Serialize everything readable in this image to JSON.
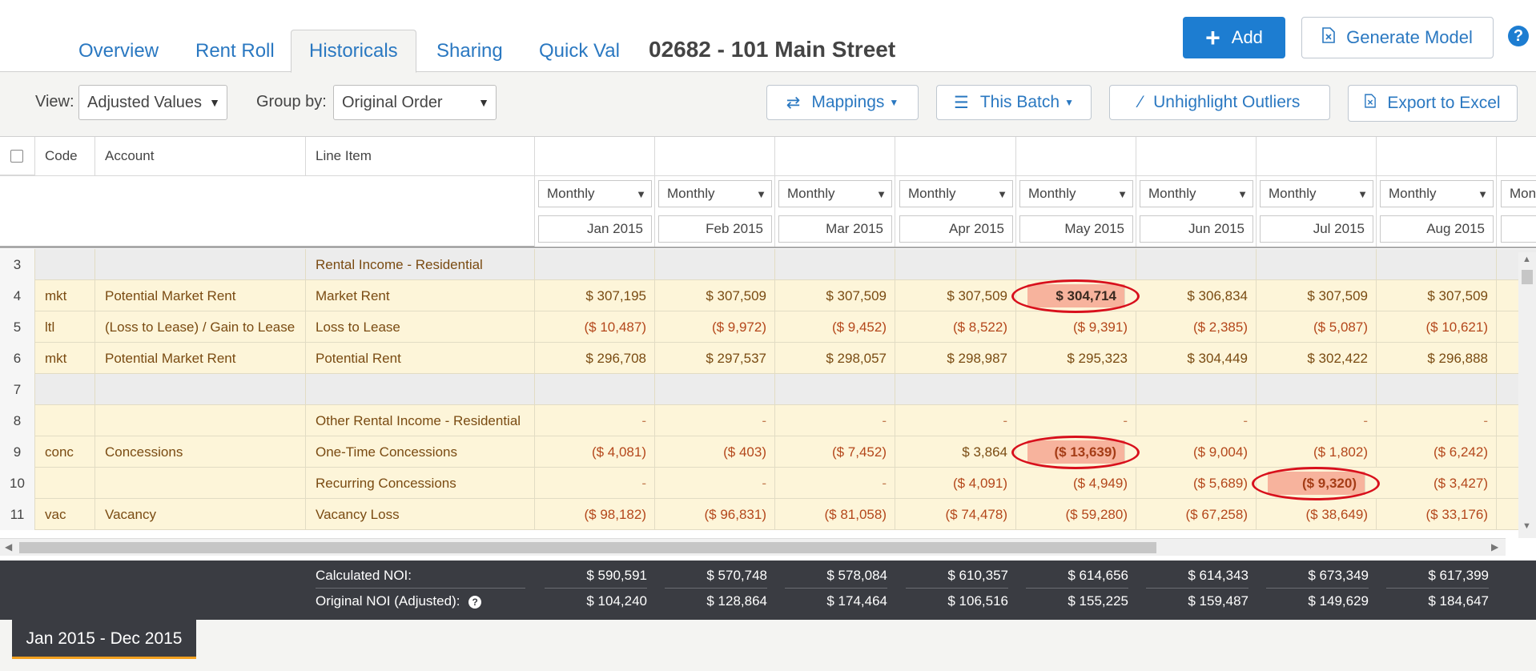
{
  "tabs": [
    {
      "label": "Overview",
      "active": false
    },
    {
      "label": "Rent Roll",
      "active": false
    },
    {
      "label": "Historicals",
      "active": true
    },
    {
      "label": "Sharing",
      "active": false
    },
    {
      "label": "Quick Val",
      "active": false
    }
  ],
  "property_title": "02682 - 101 Main Street",
  "header_buttons": {
    "add": "Add",
    "generate_model": "Generate Model",
    "help": "?"
  },
  "toolbar": {
    "view_label": "View:",
    "view_value": "Adjusted Values",
    "group_label": "Group by:",
    "group_value": "Original Order",
    "mappings": "Mappings",
    "this_batch": "This Batch",
    "unhighlight": "Unhighlight Outliers",
    "export": "Export to Excel"
  },
  "columns": {
    "code": "Code",
    "account": "Account",
    "line_item": "Line Item"
  },
  "periods": [
    {
      "type": "Monthly",
      "date": "Jan 2015"
    },
    {
      "type": "Monthly",
      "date": "Feb 2015"
    },
    {
      "type": "Monthly",
      "date": "Mar 2015"
    },
    {
      "type": "Monthly",
      "date": "Apr 2015"
    },
    {
      "type": "Monthly",
      "date": "May 2015"
    },
    {
      "type": "Monthly",
      "date": "Jun 2015"
    },
    {
      "type": "Monthly",
      "date": "Jul 2015"
    },
    {
      "type": "Monthly",
      "date": "Aug 2015"
    },
    {
      "type": "Mon",
      "date": ""
    }
  ],
  "rows": [
    {
      "num": "3",
      "code": "",
      "account": "",
      "line_item": "Rental Income - Residential",
      "kind": "header",
      "values": [
        "",
        "",
        "",
        "",
        "",
        "",
        "",
        ""
      ]
    },
    {
      "num": "4",
      "code": "mkt",
      "account": "Potential Market Rent",
      "line_item": "Market Rent",
      "kind": "data",
      "values": [
        "$ 307,195",
        "$ 307,509",
        "$ 307,509",
        "$ 307,509",
        "$ 304,714",
        "$ 306,834",
        "$ 307,509",
        "$ 307,509"
      ],
      "outliers": [
        4
      ]
    },
    {
      "num": "5",
      "code": "ltl",
      "account": "(Loss to Lease) / Gain to Lease",
      "line_item": "Loss to Lease",
      "kind": "data",
      "values": [
        "($ 10,487)",
        "($ 9,972)",
        "($ 9,452)",
        "($ 8,522)",
        "($ 9,391)",
        "($ 2,385)",
        "($ 5,087)",
        "($ 10,621)"
      ]
    },
    {
      "num": "6",
      "code": "mkt",
      "account": "Potential Market Rent",
      "line_item": "Potential Rent",
      "kind": "data",
      "values": [
        "$ 296,708",
        "$ 297,537",
        "$ 298,057",
        "$ 298,987",
        "$ 295,323",
        "$ 304,449",
        "$ 302,422",
        "$ 296,888"
      ]
    },
    {
      "num": "7",
      "code": "",
      "account": "",
      "line_item": "",
      "kind": "blank",
      "values": [
        "",
        "",
        "",
        "",
        "",
        "",
        "",
        ""
      ]
    },
    {
      "num": "8",
      "code": "",
      "account": "",
      "line_item": "Other Rental Income - Residential",
      "kind": "data",
      "values": [
        "-",
        "-",
        "-",
        "-",
        "-",
        "-",
        "-",
        "-"
      ]
    },
    {
      "num": "9",
      "code": "conc",
      "account": "Concessions",
      "line_item": "One-Time Concessions",
      "kind": "data",
      "values": [
        "($ 4,081)",
        "($ 403)",
        "($ 7,452)",
        "$ 3,864",
        "($ 13,639)",
        "($ 9,004)",
        "($ 1,802)",
        "($ 6,242)"
      ],
      "outliers": [
        4
      ]
    },
    {
      "num": "10",
      "code": "",
      "account": "",
      "line_item": "Recurring Concessions",
      "kind": "data",
      "values": [
        "-",
        "-",
        "-",
        "($ 4,091)",
        "($ 4,949)",
        "($ 5,689)",
        "($ 9,320)",
        "($ 3,427)"
      ],
      "outliers": [
        6
      ]
    },
    {
      "num": "11",
      "code": "vac",
      "account": "Vacancy",
      "line_item": "Vacancy Loss",
      "kind": "data",
      "values": [
        "($ 98,182)",
        "($ 96,831)",
        "($ 81,058)",
        "($ 74,478)",
        "($ 59,280)",
        "($ 67,258)",
        "($ 38,649)",
        "($ 33,176)"
      ]
    }
  ],
  "footer": {
    "calculated_label": "Calculated NOI:",
    "original_label": "Original NOI (Adjusted):",
    "calculated": [
      "$ 590,591",
      "$ 570,748",
      "$ 578,084",
      "$ 610,357",
      "$ 614,656",
      "$ 614,343",
      "$ 673,349",
      "$ 617,399"
    ],
    "original": [
      "$ 104,240",
      "$ 128,864",
      "$ 174,464",
      "$ 106,516",
      "$ 155,225",
      "$ 159,487",
      "$ 149,629",
      "$ 184,647"
    ]
  },
  "date_range": "Jan 2015 - Dec 2015",
  "colors": {
    "accent": "#1d7dd1",
    "row_highlight": "#fdf5d9",
    "outlier": "#f7b39d",
    "outlier_circle": "#d8101c"
  }
}
